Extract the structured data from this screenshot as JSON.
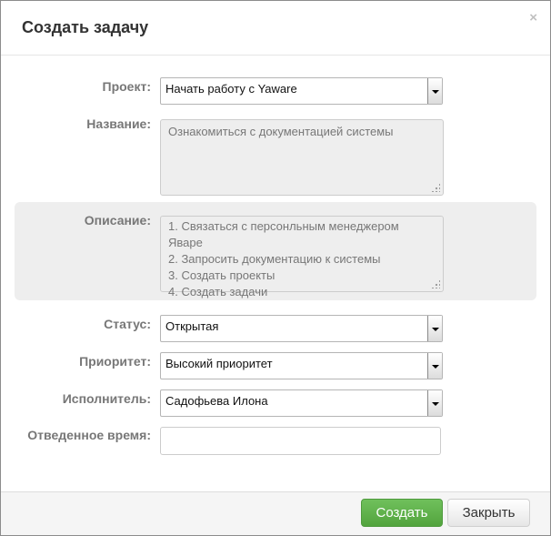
{
  "dialog": {
    "title": "Создать задачу",
    "close_glyph": "×"
  },
  "form": {
    "project": {
      "label": "Проект:",
      "value": "Начать работу с Yaware"
    },
    "name": {
      "label": "Название:",
      "value": "Ознакомиться с документацией системы"
    },
    "description": {
      "label": "Описание:",
      "lines": [
        "1. Связаться с персонльным менеджером Яваре",
        "2. Запросить документацию к системы",
        "3. Создать проекты",
        "4. Создать задачи"
      ]
    },
    "status": {
      "label": "Статус:",
      "value": "Открытая"
    },
    "priority": {
      "label": "Приоритет:",
      "value": "Высокий приоритет"
    },
    "assignee": {
      "label": "Исполнитель:",
      "value": "Садофьева Илона"
    },
    "allotted_time": {
      "label": "Отведенное время:",
      "value": ""
    }
  },
  "footer": {
    "create_label": "Создать",
    "close_label": "Закрыть"
  },
  "colors": {
    "create_button": "#5cb148",
    "label_text": "#777777",
    "panel_bg": "#eeeeee"
  }
}
